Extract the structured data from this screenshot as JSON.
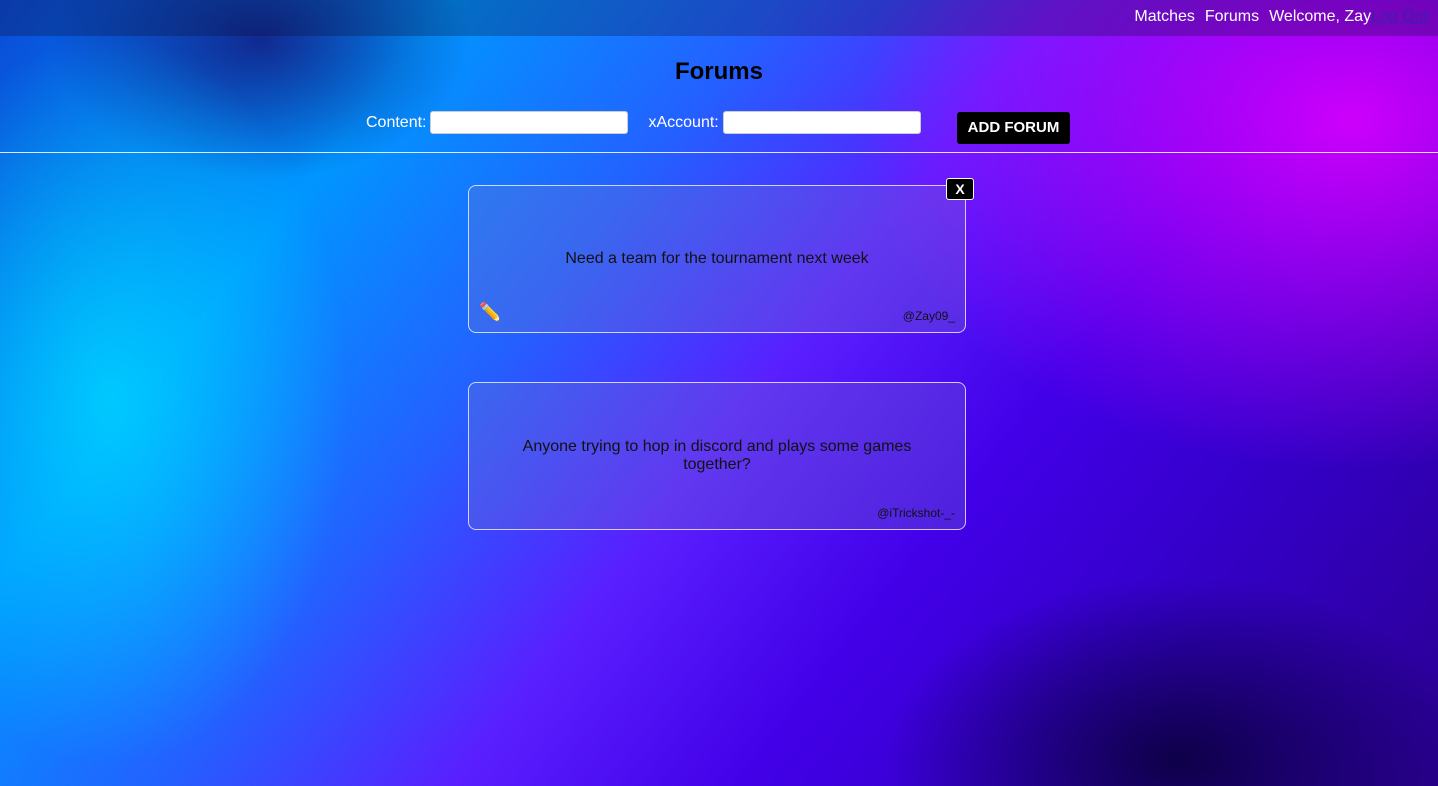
{
  "nav": {
    "matches": "Matches",
    "forums": "Forums",
    "welcome": "Welcome, Zay",
    "logout": "Log Out"
  },
  "page": {
    "title": "Forums"
  },
  "form": {
    "content_label": "Content:",
    "content_value": "",
    "xaccount_label": "xAccount:",
    "xaccount_value": "",
    "add_button": "ADD FORUM"
  },
  "forums": [
    {
      "content": "Need a team for the tournament next week",
      "account": "@Zay09_",
      "delete_label": "X",
      "edit_icon": "pencil-icon"
    },
    {
      "content": "Anyone trying to hop in discord and plays some games together?",
      "account": "@iTrickshot-_-"
    }
  ]
}
